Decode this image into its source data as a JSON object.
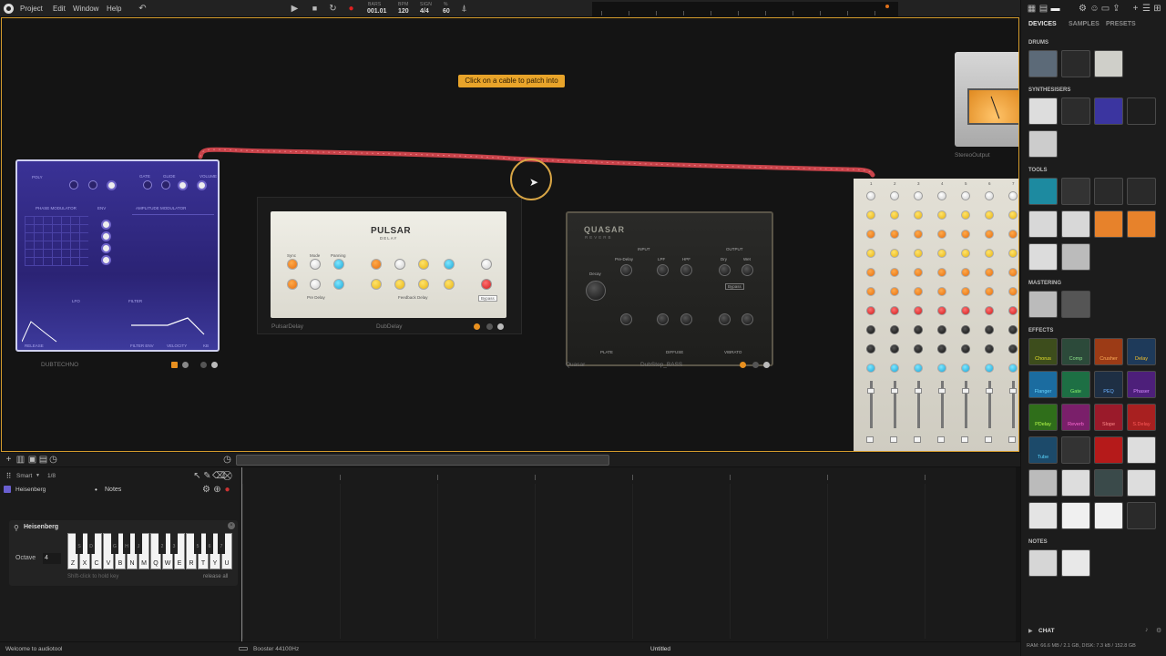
{
  "menubar": {
    "items": [
      "Project",
      "Edit",
      "Window",
      "Help"
    ],
    "transport": {
      "bars_label": "BARS",
      "bars_value": "001.01",
      "bpm_label": "BPM",
      "bpm_value": "120",
      "sign_label": "SIGN",
      "sign_value": "4/4",
      "pct_label": "%",
      "pct_value": "60"
    }
  },
  "desktop": {
    "tooltip": "Click on a cable to patch into",
    "devices": {
      "heisenberg": {
        "label": "DUBTECHNO",
        "mode": "POLY",
        "top_labels": [
          "GATE",
          "GLIDE",
          "VOLUME"
        ],
        "sections": [
          "PHASE MODULATOR",
          "ENV",
          "AMPLITUDE MODULATOR",
          "LFO",
          "FILTER"
        ],
        "bottom_labels": [
          "RELEASE",
          "FILTER ENV",
          "VELOCITY",
          "KB"
        ]
      },
      "pulsar": {
        "title": "PULSAR",
        "subtitle": "DELAY",
        "device_label": "PulsarDelay",
        "name": "DubDelay",
        "labels": [
          "Sync",
          "Mode",
          "Panning",
          "Pre Delay",
          "Feedback Delay",
          "Bypass"
        ]
      },
      "quasar": {
        "title": "QUASAR",
        "subtitle": "REVERB",
        "device_label": "Quasar",
        "name": "DubStep_BASS",
        "labels": [
          "INPUT",
          "Pre-Delay",
          "LPF",
          "HPF",
          "OUTPUT",
          "Dry",
          "Wet",
          "Decay",
          "Bypass",
          "PLATE",
          "DIFFUSE",
          "VIBRATO"
        ]
      },
      "stereo_output": {
        "label": "StereoOutput"
      },
      "mixer": {
        "channels": [
          "1",
          "2",
          "3",
          "4",
          "5",
          "6",
          "7"
        ]
      }
    }
  },
  "sequencer": {
    "mode": "Smart",
    "grid": "1/8",
    "track_name": "Heisenberg",
    "lane_name": "Notes",
    "notes_panel": {
      "title": "Heisenberg",
      "octave_label": "Octave",
      "octave_value": "4",
      "white_keys": [
        "Z",
        "X",
        "C",
        "V",
        "B",
        "N",
        "M",
        "Q",
        "W",
        "E",
        "R",
        "T",
        "Y",
        "U"
      ],
      "black_keys": [
        "S",
        "D",
        "G",
        "H",
        "J",
        "2",
        "3",
        "5",
        "6",
        "7"
      ],
      "hint": "Shift-click to hold key",
      "release": "release all"
    }
  },
  "statusbar": {
    "welcome": "Welcome to audiotool",
    "engine": "Booster 44100Hz",
    "project": "Untitled",
    "stats": "RAM: 66.6 MB / 2.1 GB, DISK: 7.3 kB / 152.8 GB"
  },
  "browser": {
    "tabs": [
      "DEVICES",
      "SAMPLES",
      "PRESETS"
    ],
    "sections": {
      "drums": "DRUMS",
      "synths": "SYNTHESISERS",
      "tools": "TOOLS",
      "mastering": "MASTERING",
      "effects": "EFFECTS",
      "notes": "NOTES"
    },
    "effects": [
      "Chorus",
      "Comp",
      "Crusher",
      "Delay",
      "Flanger",
      "Gate",
      "PEQ",
      "Phaser",
      "PDelay",
      "Reverb",
      "Slope",
      "S.Delay",
      "Tube"
    ],
    "chat": "CHAT"
  },
  "colors": {
    "accent": "#d29a2c",
    "cable": "#c8434a",
    "tooltip": "#e8a42a"
  }
}
